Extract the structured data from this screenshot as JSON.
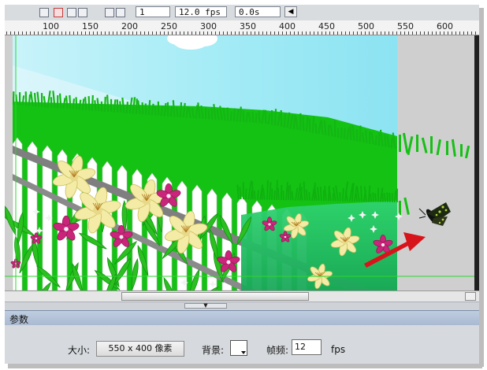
{
  "toolbar": {
    "frame_field": "1",
    "fps_field": "12.0 fps",
    "time_field": "0.0s"
  },
  "ruler": {
    "labels": [
      "100",
      "150",
      "200",
      "250",
      "300",
      "350",
      "400",
      "450",
      "500",
      "550",
      "600"
    ]
  },
  "properties": {
    "panel_title": "参数",
    "size_label": "大小:",
    "size_value": "550 x 400 像素",
    "background_label": "背景:",
    "framerate_label": "帧频:",
    "framerate_value": "12",
    "fps_unit": "fps"
  },
  "colors": {
    "sky": "#9fe9f5",
    "grass": "#12c412",
    "pasteboard": "#cfcfcf",
    "annotation_arrow": "#d8141b"
  }
}
